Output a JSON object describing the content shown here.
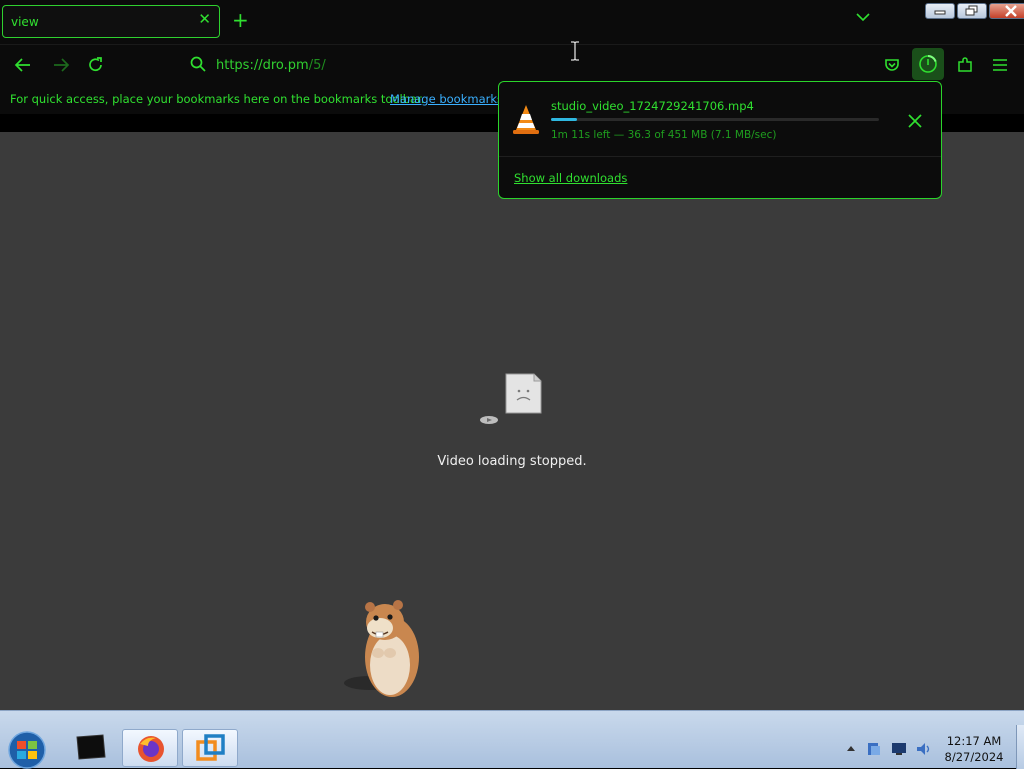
{
  "browser": {
    "tab": {
      "title": "view",
      "close_glyph": "✕"
    },
    "new_tab_glyph": "+",
    "url": {
      "host": "https://dro.pm",
      "path": "/5/"
    },
    "bookmarks": {
      "message": "For quick access, place your bookmarks here on the bookmarks toolbar.",
      "manage_link": "Manage bookmarks..."
    }
  },
  "downloads_panel": {
    "filename": "studio_video_1724729241706.mp4",
    "status": "1m 11s left — 36.3 of 451 MB (7.1 MB/sec)",
    "progress_percent": 8,
    "show_all": "Show all downloads"
  },
  "content": {
    "message": "Video loading stopped."
  },
  "taskbar": {
    "time": "12:17 AM",
    "date": "8/27/2024"
  },
  "colors": {
    "accent": "#30e030",
    "content_bg": "#3b3b3b",
    "progress": "#2fb8e0"
  }
}
